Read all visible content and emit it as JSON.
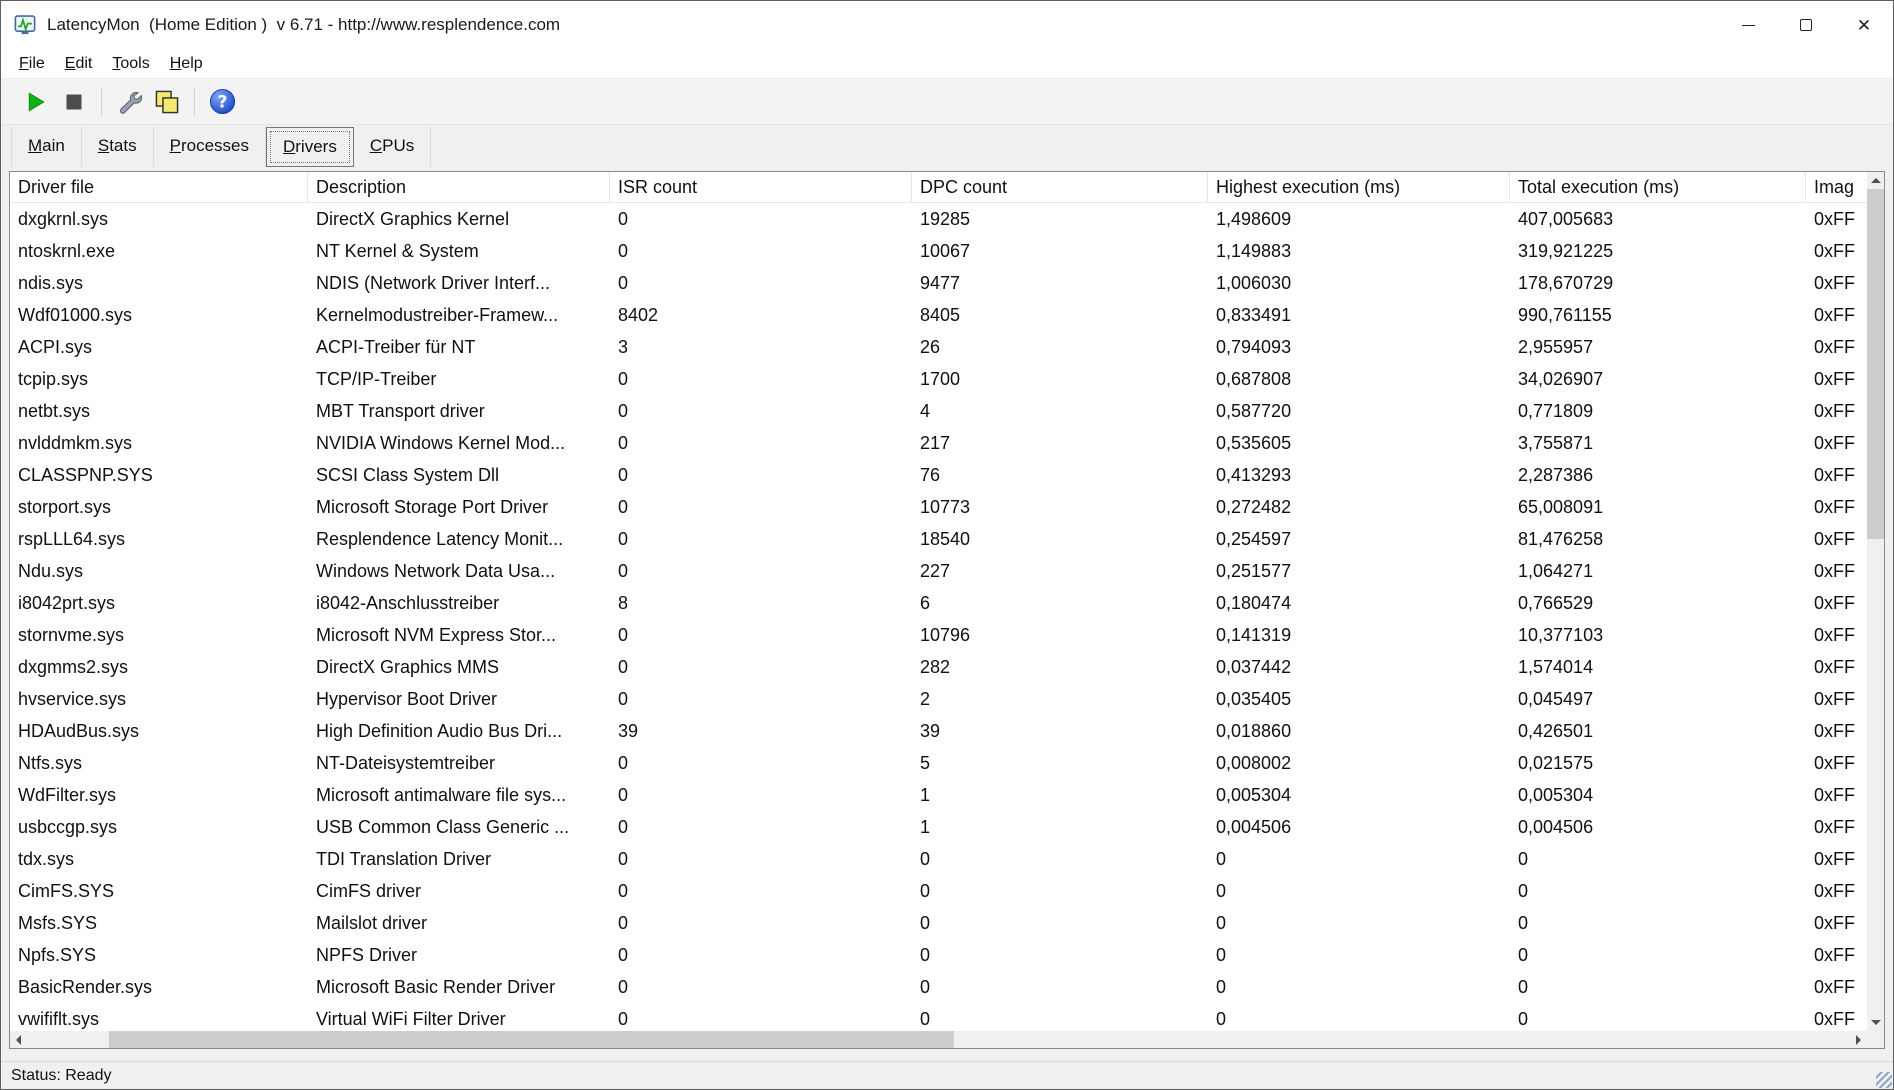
{
  "window": {
    "title": "LatencyMon  (Home Edition )  v 6.71 - http://www.resplendence.com"
  },
  "menu": {
    "items": [
      "File",
      "Edit",
      "Tools",
      "Help"
    ]
  },
  "toolbar": {
    "buttons": [
      "start-monitor",
      "stop-monitor",
      "options",
      "copy-report",
      "help"
    ]
  },
  "tabs": [
    "Main",
    "Stats",
    "Processes",
    "Drivers",
    "CPUs"
  ],
  "active_tab": "Drivers",
  "table": {
    "columns": [
      "Driver file",
      "Description",
      "ISR count",
      "DPC count",
      "Highest execution (ms)",
      "Total execution (ms)",
      "Imag"
    ],
    "rows": [
      [
        "dxgkrnl.sys",
        "DirectX Graphics Kernel",
        "0",
        "19285",
        "1,498609",
        "407,005683",
        "0xFF"
      ],
      [
        "ntoskrnl.exe",
        "NT Kernel & System",
        "0",
        "10067",
        "1,149883",
        "319,921225",
        "0xFF"
      ],
      [
        "ndis.sys",
        "NDIS (Network Driver Interf...",
        "0",
        "9477",
        "1,006030",
        "178,670729",
        "0xFF"
      ],
      [
        "Wdf01000.sys",
        "Kernelmodustreiber-Framew...",
        "8402",
        "8405",
        "0,833491",
        "990,761155",
        "0xFF"
      ],
      [
        "ACPI.sys",
        "ACPI-Treiber für NT",
        "3",
        "26",
        "0,794093",
        "2,955957",
        "0xFF"
      ],
      [
        "tcpip.sys",
        "TCP/IP-Treiber",
        "0",
        "1700",
        "0,687808",
        "34,026907",
        "0xFF"
      ],
      [
        "netbt.sys",
        "MBT Transport driver",
        "0",
        "4",
        "0,587720",
        "0,771809",
        "0xFF"
      ],
      [
        "nvlddmkm.sys",
        "NVIDIA Windows Kernel Mod...",
        "0",
        "217",
        "0,535605",
        "3,755871",
        "0xFF"
      ],
      [
        "CLASSPNP.SYS",
        "SCSI Class System Dll",
        "0",
        "76",
        "0,413293",
        "2,287386",
        "0xFF"
      ],
      [
        "storport.sys",
        "Microsoft Storage Port Driver",
        "0",
        "10773",
        "0,272482",
        "65,008091",
        "0xFF"
      ],
      [
        "rspLLL64.sys",
        "Resplendence Latency Monit...",
        "0",
        "18540",
        "0,254597",
        "81,476258",
        "0xFF"
      ],
      [
        "Ndu.sys",
        "Windows Network Data Usa...",
        "0",
        "227",
        "0,251577",
        "1,064271",
        "0xFF"
      ],
      [
        "i8042prt.sys",
        "i8042-Anschlusstreiber",
        "8",
        "6",
        "0,180474",
        "0,766529",
        "0xFF"
      ],
      [
        "stornvme.sys",
        "Microsoft NVM Express Stor...",
        "0",
        "10796",
        "0,141319",
        "10,377103",
        "0xFF"
      ],
      [
        "dxgmms2.sys",
        "DirectX Graphics MMS",
        "0",
        "282",
        "0,037442",
        "1,574014",
        "0xFF"
      ],
      [
        "hvservice.sys",
        "Hypervisor Boot Driver",
        "0",
        "2",
        "0,035405",
        "0,045497",
        "0xFF"
      ],
      [
        "HDAudBus.sys",
        "High Definition Audio Bus Dri...",
        "39",
        "39",
        "0,018860",
        "0,426501",
        "0xFF"
      ],
      [
        "Ntfs.sys",
        "NT-Dateisystemtreiber",
        "0",
        "5",
        "0,008002",
        "0,021575",
        "0xFF"
      ],
      [
        "WdFilter.sys",
        "Microsoft antimalware file sys...",
        "0",
        "1",
        "0,005304",
        "0,005304",
        "0xFF"
      ],
      [
        "usbccgp.sys",
        "USB Common Class Generic ...",
        "0",
        "1",
        "0,004506",
        "0,004506",
        "0xFF"
      ],
      [
        "tdx.sys",
        "TDI Translation Driver",
        "0",
        "0",
        "0",
        "0",
        "0xFF"
      ],
      [
        "CimFS.SYS",
        "CimFS driver",
        "0",
        "0",
        "0",
        "0",
        "0xFF"
      ],
      [
        "Msfs.SYS",
        "Mailslot driver",
        "0",
        "0",
        "0",
        "0",
        "0xFF"
      ],
      [
        "Npfs.SYS",
        "NPFS Driver",
        "0",
        "0",
        "0",
        "0",
        "0xFF"
      ],
      [
        "BasicRender.sys",
        "Microsoft Basic Render Driver",
        "0",
        "0",
        "0",
        "0",
        "0xFF"
      ],
      [
        "vwififlt.sys",
        "Virtual WiFi Filter Driver",
        "0",
        "0",
        "0",
        "0",
        "0xFF"
      ]
    ]
  },
  "statusbar": {
    "text": "Status: Ready"
  },
  "colors": {
    "start_green": "#12b212",
    "stop_gray": "#4d4d4d",
    "help_blue": "#2b5cd9",
    "copy_yellow": "#f2ea71"
  }
}
